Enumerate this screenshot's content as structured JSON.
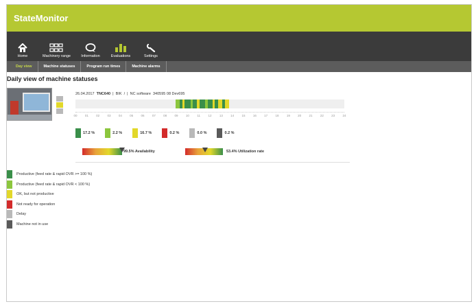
{
  "app": {
    "title": "StateMonitor"
  },
  "nav": [
    {
      "label": "Home",
      "icon": "home-icon"
    },
    {
      "label": "Machinery range",
      "icon": "grid-icon"
    },
    {
      "label": "Information",
      "icon": "speech-bubble-icon"
    },
    {
      "label": "Evaluations",
      "icon": "bar-chart-icon"
    },
    {
      "label": "Settings",
      "icon": "wrench-icon"
    }
  ],
  "subnav": [
    {
      "label": "Day view",
      "active": true
    },
    {
      "label": "Machine statuses",
      "active": false
    },
    {
      "label": "Program run times",
      "active": false
    },
    {
      "label": "Machine alarms",
      "active": false
    }
  ],
  "page": {
    "title": "Daily view of machine statuses"
  },
  "machine": {
    "date": "26.04.2017",
    "control": "TNC640",
    "separator1": "|",
    "code": "BIK",
    "separator2": "/",
    "separator3": "|",
    "software": "NC software",
    "software_version": "340595 08 Dev695"
  },
  "timeline": {
    "hours": [
      "00",
      "01",
      "02",
      "03",
      "04",
      "05",
      "06",
      "07",
      "08",
      "09",
      "10",
      "11",
      "12",
      "13",
      "14",
      "15",
      "16",
      "17",
      "18",
      "19",
      "20",
      "21",
      "22",
      "23",
      "24"
    ]
  },
  "percentages": [
    {
      "value": "17.2 %",
      "color": "#3a8f4a"
    },
    {
      "value": "2.2 %",
      "color": "#8cc63e"
    },
    {
      "value": "16.7 %",
      "color": "#e2d82a"
    },
    {
      "value": "0.2 %",
      "color": "#d32b2b"
    },
    {
      "value": "0.0 %",
      "color": "#b9b9b9"
    },
    {
      "value": "0.2 %",
      "color": "#5a5a5a"
    }
  ],
  "kpis": {
    "availability": {
      "label": "99.5% Availability",
      "value": 0.995
    },
    "utilization": {
      "label": "53.4% Utilization rate",
      "value": 0.534
    }
  },
  "legend": [
    {
      "label": "Productive (feed rate & rapid OVR >= 100 %)",
      "color": "#3a8f4a"
    },
    {
      "label": "Productive (feed rate & rapid OVR < 100 %)",
      "color": "#8cc63e"
    },
    {
      "label": "OK, but not productive",
      "color": "#e2d82a"
    },
    {
      "label": "Not ready for operation",
      "color": "#d32b2b"
    },
    {
      "label": "Delay",
      "color": "#b9b9b9"
    },
    {
      "label": "Machine not in use",
      "color": "#5a5a5a"
    }
  ],
  "colors": {
    "brand": "#b5c832",
    "navbar": "#3b3b3b",
    "subnav": "#5c5c5c",
    "active_tab": "#c7d84a"
  }
}
